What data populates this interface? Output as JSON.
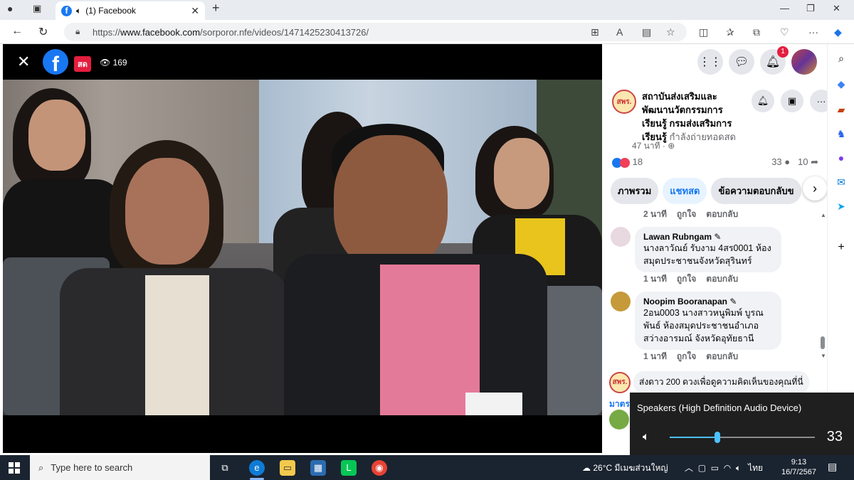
{
  "browser": {
    "tab_title": "(1) Facebook",
    "url_prefix": "https://",
    "url_domain": "www.facebook.com",
    "url_path": "/sorporor.nfe/videos/1471425230413726/"
  },
  "video": {
    "live_label": "สด",
    "viewer_count": "169"
  },
  "panel": {
    "notifications_count": "1",
    "page_avatar_text": "สพร.",
    "page_name": "สถาบันส่งเสริมและพัฒนานวัตกรรมการเรียนรู้ กรมส่งเสริมการเรียนรู้",
    "page_status": " กำลังถ่ายทอดสด",
    "page_time": "47 นาที · ",
    "reactions_count": "18",
    "comments_count": "33",
    "shares_count": "10",
    "tabs": [
      "ภาพรวม",
      "แชทสด",
      "ข้อความตอบกลับข"
    ],
    "meta_time": "2 นาที",
    "meta_like": "ถูกใจ",
    "meta_reply": "ตอบกลับ",
    "comments": [
      {
        "name": "Lawan Rubngam",
        "text": "นางลาวัณย์ รับงาม 4สร0001 ห้องสมุดประชาชนจังหวัดสุรินทร์",
        "time": "1 นาที",
        "like": "ถูกใจ",
        "reply": "ตอบกลับ"
      },
      {
        "name": "Noopim Booranapan",
        "text": "2อน0003 นางสาวหนูพิมพ์ บูรณพันธ์ ห้องสมุดประชาชนอำเภอสว่างอารมณ์ จังหวัดอุทัยธานี",
        "time": "1 นาที",
        "like": "ถูกใจ",
        "reply": "ตอบกลับ"
      }
    ],
    "promo_text": "ส่งดาว 200 ดวงเพื่อดูความคิดเห็นของคุณที่นี่",
    "reply_label": "มาตร"
  },
  "volume": {
    "device": "Speakers (High Definition Audio Device)",
    "level": "33",
    "level_fraction": 0.33
  },
  "taskbar": {
    "search_placeholder": "Type here to search",
    "temperature": "26°C",
    "weather_text": "มีเมฆส่วนใหญ่",
    "language": "ไทย",
    "time": "9:13",
    "date": "16/7/2567"
  },
  "colors": {
    "facebook_blue": "#1877f2",
    "live_red": "#e41e3f",
    "taskbar": "#1a2430",
    "volume_accent": "#4cc2ff"
  }
}
